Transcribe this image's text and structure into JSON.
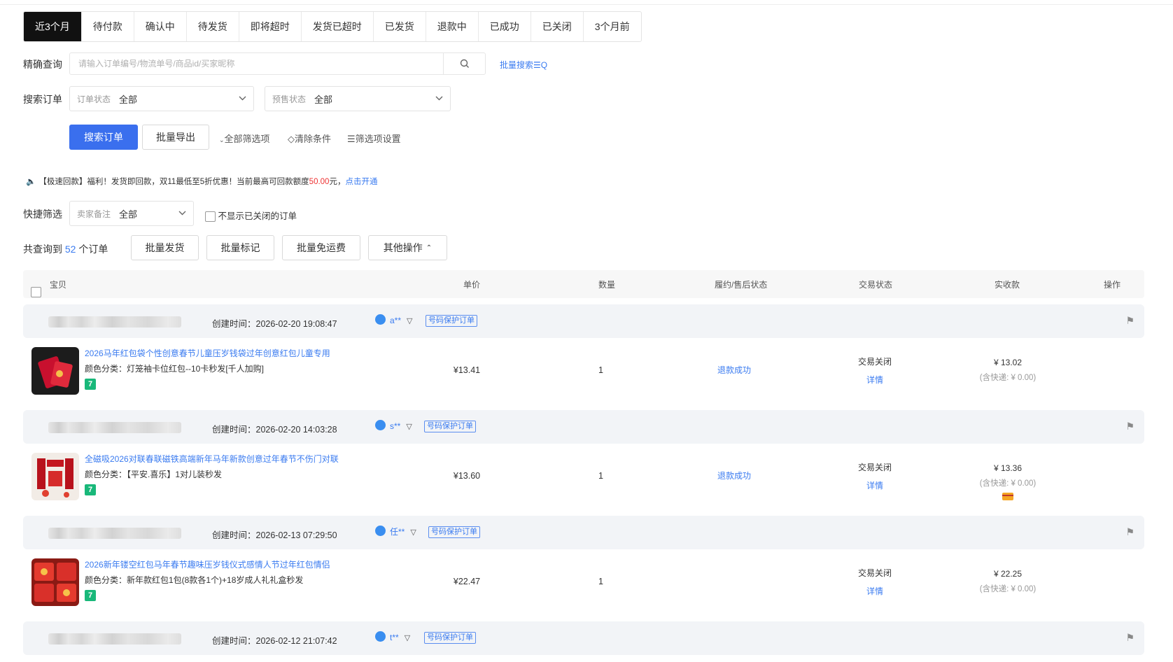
{
  "tabs": [
    "近3个月",
    "待付款",
    "确认中",
    "待发货",
    "即将超时",
    "发货已超时",
    "已发货",
    "退款中",
    "已成功",
    "已关闭",
    "3个月前"
  ],
  "precise": {
    "label": "精确查询",
    "placeholder": "请输入订单编号/物流单号/商品id/买家昵称",
    "batch_search": "批量搜索☰Q"
  },
  "search_orders": {
    "label": "搜索订单",
    "order_status": {
      "label": "订单状态",
      "value": "全部"
    },
    "presale_status": {
      "label": "预售状态",
      "value": "全部"
    }
  },
  "actions": {
    "search": "搜索订单",
    "export": "批量导出",
    "all_filters": "全部筛选项",
    "clear": "清除条件",
    "filter_settings": "筛选项设置"
  },
  "notice": {
    "text1": "【极速回款】福利！发货即回款，双11最低至5折优惠！当前最高可回款额度",
    "amount": "50.00",
    "text2": "元，",
    "link": "点击开通"
  },
  "quick": {
    "label": "快捷筛选",
    "seller_note": {
      "label": "卖家备注",
      "value": "全部"
    },
    "hide_closed": "不显示已关闭的订单"
  },
  "summary": {
    "prefix": "共查询到 ",
    "count": "52",
    "suffix": " 个订单"
  },
  "batch": {
    "ship": "批量发货",
    "mark": "批量标记",
    "free": "批量免运费",
    "other": "其他操作"
  },
  "columns": {
    "item": "宝贝",
    "price": "单价",
    "qty": "数量",
    "fulfil": "履约/售后状态",
    "trade": "交易状态",
    "paid": "实收款",
    "ops": "操作"
  },
  "orders": [
    {
      "created": "创建时间：2026-02-20 19:08:47",
      "buyer": "a**",
      "protect": "号码保护订单",
      "title": "2026马年红包袋个性创意春节儿童压岁钱袋过年创意红包儿童专用",
      "sku": "颜色分类：灯笼袖卡位红包--10卡秒发[千人加购]",
      "price": "¥13.41",
      "qty": "1",
      "after": "退款成功",
      "state": "交易关闭",
      "detail": "详情",
      "amount": "¥ 13.02",
      "ship": "(含快递: ¥ 0.00)",
      "seven": "7"
    },
    {
      "created": "创建时间：2026-02-20 14:03:28",
      "buyer": "s**",
      "protect": "号码保护订单",
      "title": "全磁吸2026对联春联磁铁高端新年马年新款创意过年春节不伤门对联",
      "sku": "颜色分类：【平安.喜乐】1对儿装秒发",
      "price": "¥13.60",
      "qty": "1",
      "after": "退款成功",
      "state": "交易关闭",
      "detail": "详情",
      "amount": "¥ 13.36",
      "ship": "(含快递: ¥ 0.00)",
      "seven": "7"
    },
    {
      "created": "创建时间：2026-02-13 07:29:50",
      "buyer": "任**",
      "protect": "号码保护订单",
      "title": "2026新年镂空红包马年春节趣味压岁钱仪式感情人节过年红包情侣",
      "sku": "颜色分类：新年款红包1包(8款各1个)+18岁成人礼礼盒秒发",
      "price": "¥22.47",
      "qty": "1",
      "after": "",
      "state": "交易关闭",
      "detail": "详情",
      "amount": "¥ 22.25",
      "ship": "(含快递: ¥ 0.00)",
      "seven": "7"
    },
    {
      "created": "创建时间：2026-02-12 21:07:42",
      "buyer": "t**",
      "protect": "号码保护订单"
    }
  ]
}
